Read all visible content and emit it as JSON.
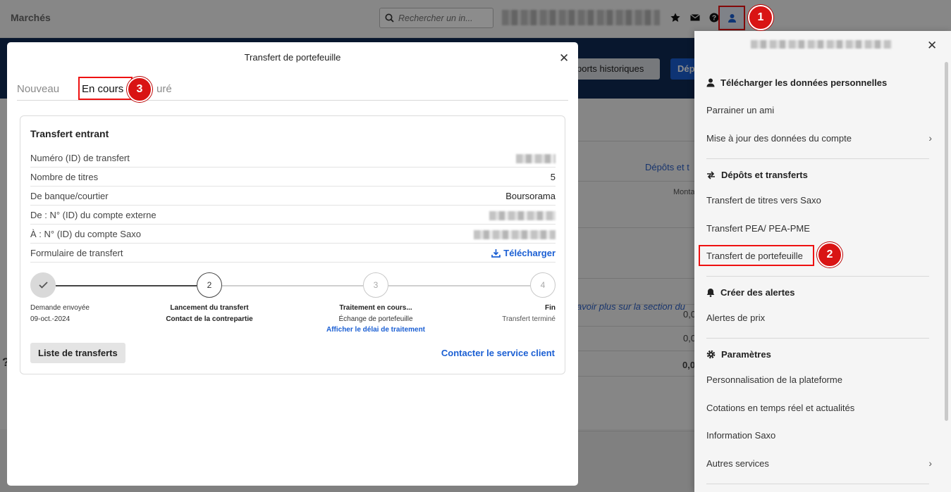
{
  "app": {
    "title": "Marchés",
    "search_placeholder": "Rechercher un in...",
    "hero_buttons": {
      "reports": "ports historiques",
      "deposit": "Dép"
    },
    "bg_link": "Dépôts et t",
    "bg_col_header": "Monta",
    "bg_values": [
      "0,0",
      "0,0",
      "0,0"
    ],
    "bg_italic_link": "avoir plus sur la section du",
    "bg_question": "?"
  },
  "panel": {
    "sections": [
      {
        "label": "Télécharger les données personnelles",
        "icon": "person-icon"
      },
      {
        "label": "Dépôts et transferts",
        "icon": "transfer-icon"
      },
      {
        "label": "Créer des alertes",
        "icon": "bell-icon"
      },
      {
        "label": "Paramètres",
        "icon": "gear-icon"
      }
    ],
    "items": {
      "parrainer": "Parrainer un ami",
      "mise_a_jour": "Mise à jour des données du compte",
      "transfert_titres": "Transfert de titres vers Saxo",
      "transfert_pea": "Transfert PEA/ PEA-PME",
      "transfert_portefeuille": "Transfert de portefeuille",
      "alertes_prix": "Alertes de prix",
      "personnalisation": "Personnalisation de la plateforme",
      "cotations": "Cotations en temps réel et actualités",
      "information": "Information Saxo",
      "autres": "Autres services"
    }
  },
  "modal": {
    "title": "Transfert de portefeuille",
    "tabs": [
      "Nouveau",
      "En cours",
      "uré"
    ],
    "card_title": "Transfert entrant",
    "rows": [
      {
        "key": "Numéro (ID) de transfert",
        "value": ""
      },
      {
        "key": "Nombre de titres",
        "value": "5"
      },
      {
        "key": "De banque/courtier",
        "value": "Boursorama"
      },
      {
        "key": "De : N° (ID) du compte externe",
        "value": ""
      },
      {
        "key": "À : N° (ID) du compte Saxo",
        "value": ""
      },
      {
        "key": "Formulaire de transfert",
        "value": "Télécharger"
      }
    ],
    "steps": [
      {
        "num": "",
        "line1": "Demande envoyée",
        "line2": "09-oct.-2024",
        "line3": ""
      },
      {
        "num": "2",
        "line1": "Lancement du transfert",
        "line2": "Contact de la contrepartie",
        "line3": ""
      },
      {
        "num": "3",
        "line1": "Traitement en cours...",
        "line2": "Échange de portefeuille",
        "line3": "Afficher le délai de traitement"
      },
      {
        "num": "4",
        "line1": "Fin",
        "line2": "Transfert terminé",
        "line3": ""
      }
    ],
    "list_button": "Liste de transferts",
    "contact_link": "Contacter le service client"
  },
  "badges": [
    "1",
    "2",
    "3"
  ],
  "colors": {
    "highlight": "#e11111",
    "badge": "#d91414",
    "link": "#1b5fd3",
    "hero": "#0f2a55"
  }
}
